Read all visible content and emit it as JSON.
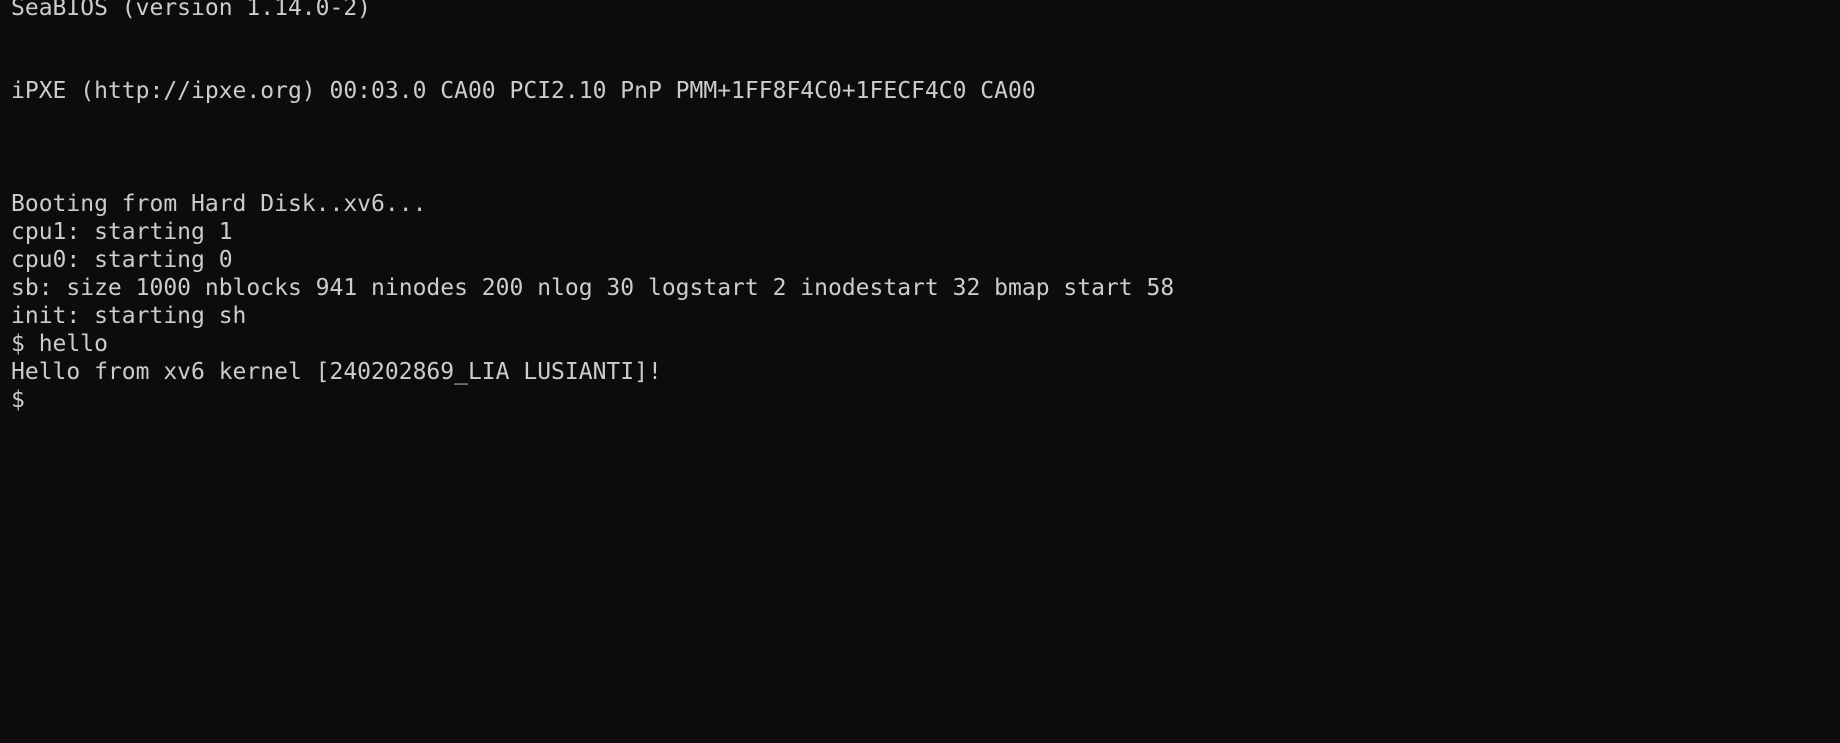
{
  "terminal": {
    "lines": [
      "SeaBIOS (version 1.14.0-2)",
      "iPXE (http://ipxe.org) 00:03.0 CA00 PCI2.10 PnP PMM+1FF8F4C0+1FECF4C0 CA00",
      "Booting from Hard Disk..xv6...",
      "cpu1: starting 1",
      "cpu0: starting 0",
      "sb: size 1000 nblocks 941 ninodes 200 nlog 30 logstart 2 inodestart 32 bmap start 58",
      "init: starting sh",
      "$ hello",
      "Hello from xv6 kernel [240202869_LIA LUSIANTI]!",
      "$"
    ]
  },
  "colors": {
    "background": "#0c0c0c",
    "foreground": "#cccccc"
  }
}
